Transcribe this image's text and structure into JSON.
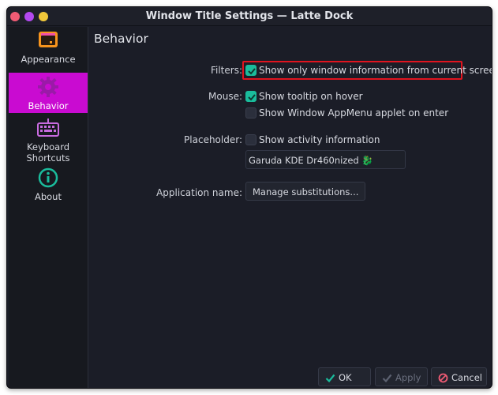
{
  "window": {
    "title": "Window Title Settings — Latte Dock"
  },
  "sidebar": {
    "items": [
      {
        "label": "Appearance",
        "icon": "appearance-icon",
        "active": false
      },
      {
        "label": "Behavior",
        "icon": "behavior-gear-icon",
        "active": true
      },
      {
        "label": "Keyboard\nShortcuts",
        "icon": "keyboard-icon",
        "active": false
      },
      {
        "label": "About",
        "icon": "info-icon",
        "active": false
      }
    ]
  },
  "page": {
    "heading": "Behavior",
    "filters": {
      "label": "Filters:",
      "show_only_current_screen": {
        "label": "Show only window information from current screen",
        "checked": true
      }
    },
    "mouse": {
      "label": "Mouse:",
      "tooltip_on_hover": {
        "label": "Show tooltip on hover",
        "checked": true
      },
      "appmenu_on_enter": {
        "label": "Show Window AppMenu applet on enter",
        "checked": false
      }
    },
    "placeholder": {
      "label": "Placeholder:",
      "activity_info": {
        "label": "Show activity information",
        "checked": false
      },
      "text_value": "Garuda KDE Dr460nized 🐉"
    },
    "application_name": {
      "label": "Application name:",
      "button": "Manage substitutions..."
    }
  },
  "footer": {
    "ok": "OK",
    "apply": "Apply",
    "cancel": "Cancel"
  },
  "colors": {
    "accent_active": "#c90bd1",
    "checkbox_checked": "#1abc9c",
    "highlight_box": "#e0141f"
  }
}
